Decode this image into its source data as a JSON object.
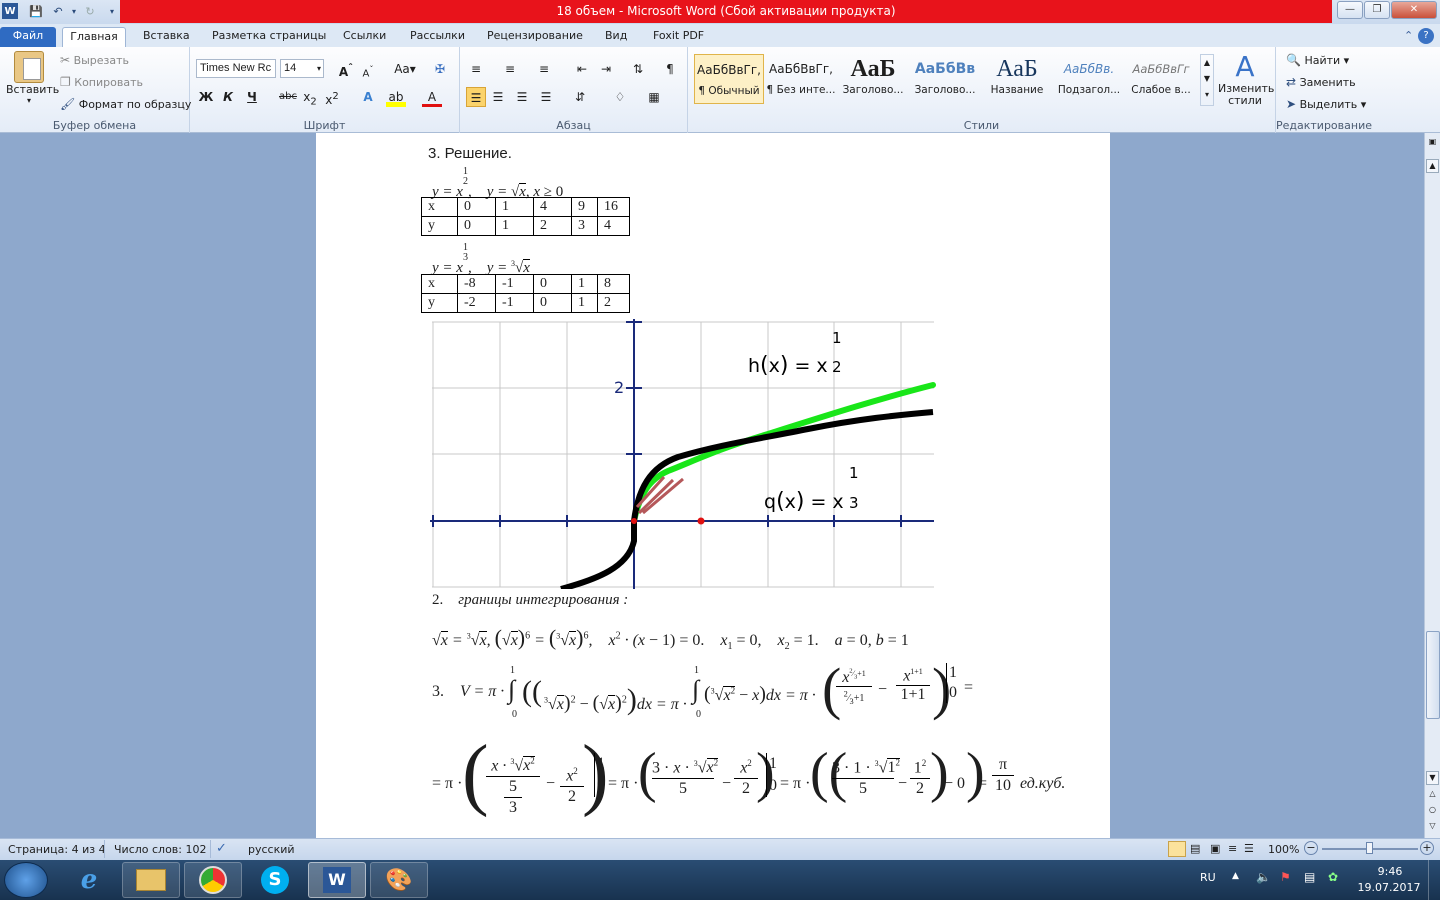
{
  "window": {
    "title": "18 объем  -  Microsoft Word (Сбой активации продукта)"
  },
  "tabs": [
    "Файл",
    "Главная",
    "Вставка",
    "Разметка страницы",
    "Ссылки",
    "Рассылки",
    "Рецензирование",
    "Вид",
    "Foxit PDF"
  ],
  "ribbon": {
    "clipboard": {
      "paste": "Вставить",
      "cut": "Вырезать",
      "copy": "Копировать",
      "format_painter": "Формат по образцу",
      "label": "Буфер обмена"
    },
    "font": {
      "name": "Times New Rc",
      "size": "14",
      "label": "Шрифт",
      "bold": "Ж",
      "italic": "К",
      "underline": "Ч",
      "strike": "abc"
    },
    "paragraph": {
      "label": "Абзац"
    },
    "styles": {
      "label": "Стили",
      "change": "Изменить стили",
      "items": [
        {
          "sample": "АаБбВвГг,",
          "name": "¶ Обычный"
        },
        {
          "sample": "АаБбВвГг,",
          "name": "¶ Без инте..."
        },
        {
          "sample": "АаБ",
          "name": "Заголово..."
        },
        {
          "sample": "АаБбВв",
          "name": "Заголово..."
        },
        {
          "sample": "АаБ",
          "name": "Название"
        },
        {
          "sample": "АаБбВв.",
          "name": "Подзагол..."
        },
        {
          "sample": "АаБбВвГг",
          "name": "Слабое в..."
        }
      ]
    },
    "editing": {
      "label": "Редактирование",
      "find": "Найти",
      "replace": "Заменить",
      "select": "Выделить"
    }
  },
  "document": {
    "heading": "3. Решение.",
    "table1": {
      "rows": [
        [
          "x",
          "0",
          "1",
          "4",
          "9",
          "16"
        ],
        [
          "y",
          "0",
          "1",
          "2",
          "3",
          "4"
        ]
      ]
    },
    "table2": {
      "rows": [
        [
          "x",
          "-8",
          "-1",
          "0",
          "1",
          "8"
        ],
        [
          "y",
          "-2",
          "-1",
          "0",
          "1",
          "2"
        ]
      ]
    },
    "graph": {
      "h_label": "h",
      "q_label": "q",
      "var": "x",
      "eq": "=",
      "exp_num": "1",
      "exp_h_den": "2",
      "exp_q_den": "3",
      "tick_2": "2",
      "curve_colors": {
        "h": "#19e619",
        "q": "#000000",
        "region": "#b5585a"
      }
    },
    "step2_num": "2.",
    "step2_text": "границы интегрирования :",
    "step3_num": "3.",
    "units": "ед.куб."
  },
  "status": {
    "page": "Страница: 4 из 4",
    "words": "Число слов: 102",
    "lang": "русский",
    "zoom": "100%"
  },
  "taskbar": {
    "lang": "RU",
    "time": "9:46",
    "date": "19.07.2017"
  }
}
